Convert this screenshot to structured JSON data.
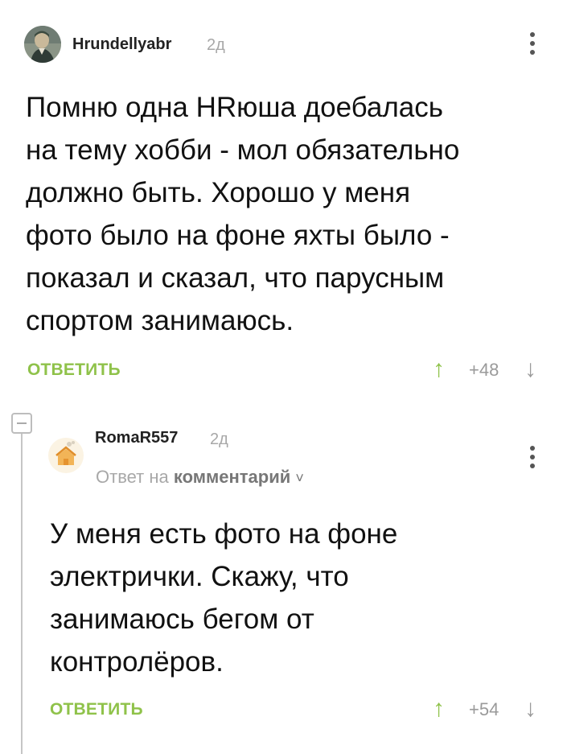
{
  "comments": [
    {
      "username": "Hrundellyabr",
      "time": "2д",
      "text": [
        "Помню одна HRюша доебалась",
        "на тему хобби - мол обязательно",
        "должно быть. Хорошо у меня",
        "фото было на фоне яхты было -",
        "показал и сказал, что парусным",
        "спортом занимаюсь."
      ],
      "reply_label": "ОТВЕТИТЬ",
      "rating": "+48",
      "vote_up": "↑",
      "vote_down": "↓"
    },
    {
      "username": "RomaR557",
      "time": "2д",
      "reply_prefix": "Ответ на",
      "reply_link": "комментарий",
      "reply_chevron": "˅",
      "text": [
        "У меня есть фото на фоне",
        "электрички. Скажу, что",
        "занимаюсь бегом от",
        "контролёров."
      ],
      "reply_label": "ОТВЕТИТЬ",
      "rating": "+54",
      "vote_up": "↑",
      "vote_down": "↓"
    }
  ],
  "icons": {
    "menu": "kebab-menu-icon",
    "collapse": "collapse-thread-icon"
  },
  "colors": {
    "accent": "#8fc24a",
    "muted": "#a8a8a8",
    "text": "#111111"
  }
}
